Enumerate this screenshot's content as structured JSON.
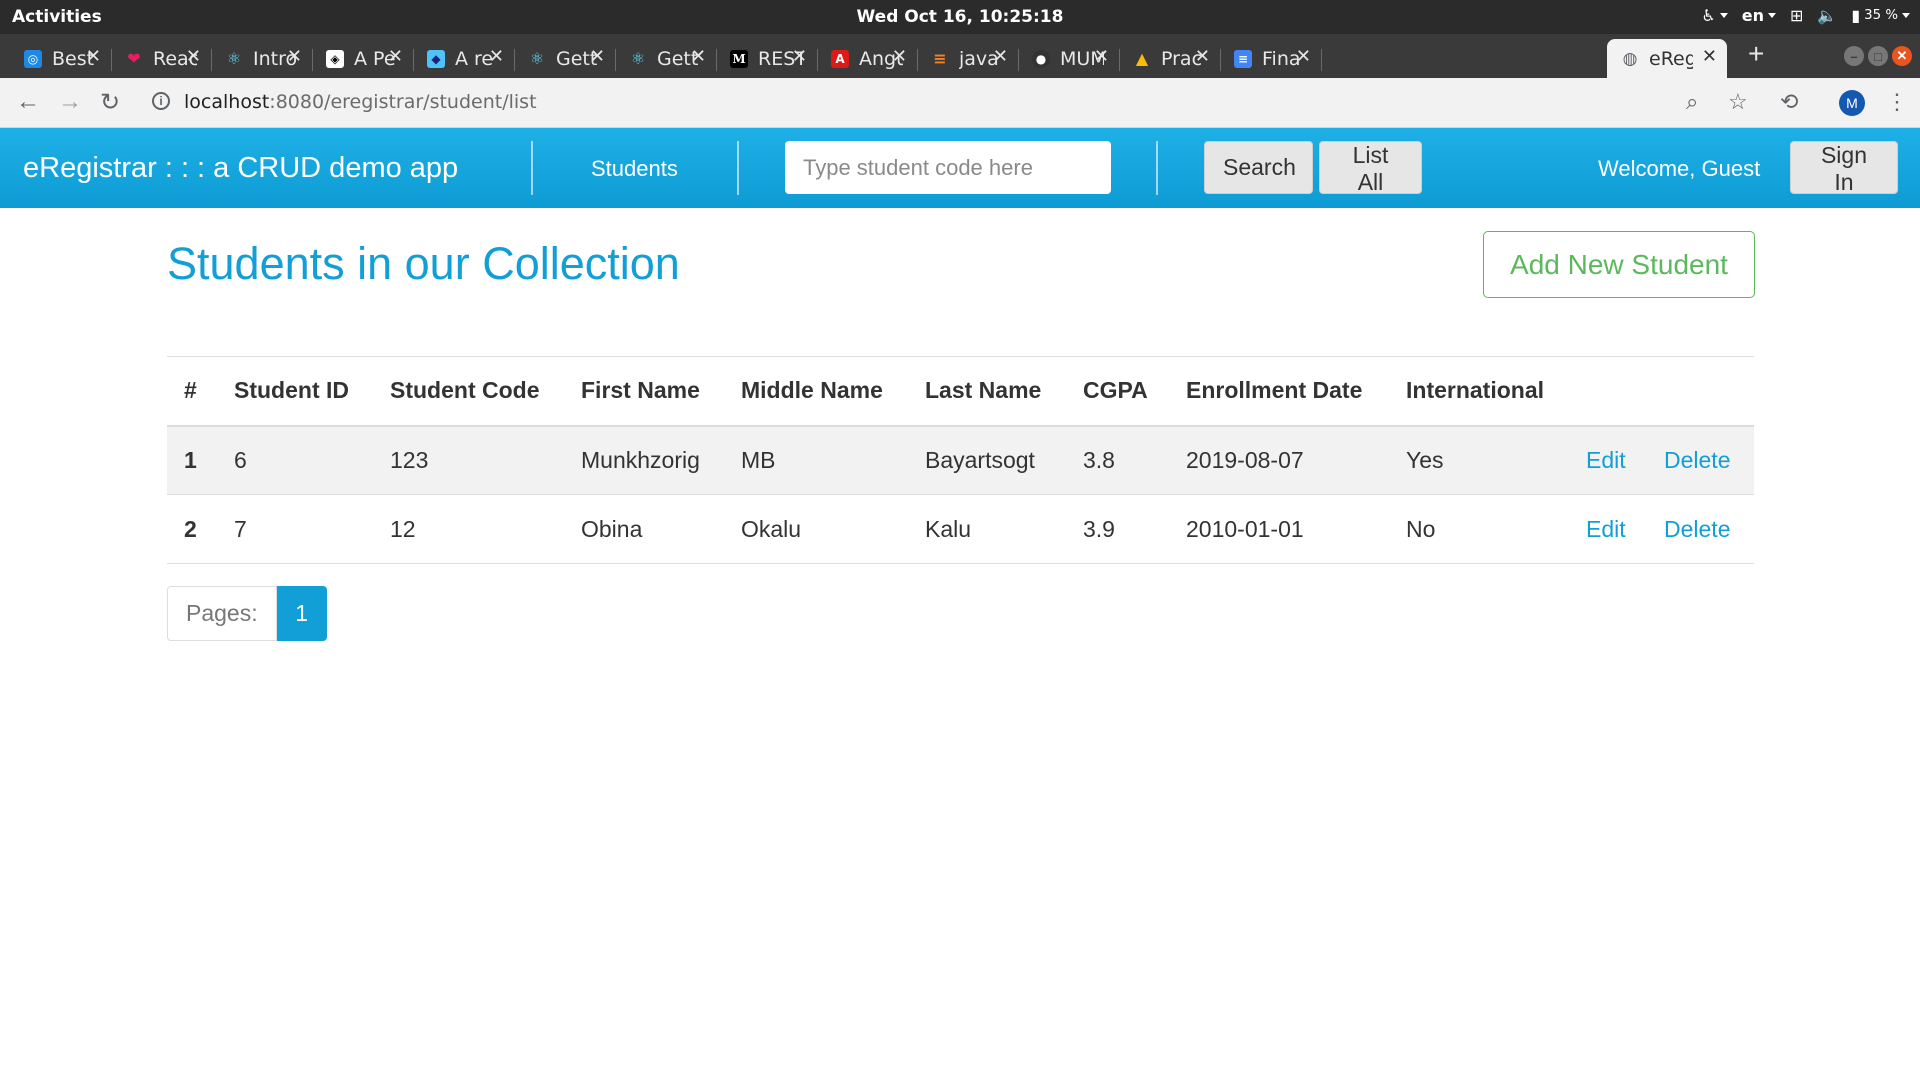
{
  "os_bar": {
    "activities": "Activities",
    "clock": "Wed Oct 16, 10:25:18",
    "language": "en",
    "battery": "35 %"
  },
  "tabs": [
    {
      "title": "Best",
      "color": "#1e88e5",
      "icon": "react-icon"
    },
    {
      "title": "Reac",
      "color": "#e91e63",
      "icon": "heart-icon"
    },
    {
      "title": "Intro",
      "color": "#61dafb",
      "icon": "react-icon"
    },
    {
      "title": "A Pe",
      "color": "#ffffff",
      "icon": "codepen-icon"
    },
    {
      "title": "A re",
      "color": "#4fc3f7",
      "icon": "tag-icon"
    },
    {
      "title": "Gett",
      "color": "#61dafb",
      "icon": "react-icon"
    },
    {
      "title": "Gett",
      "color": "#61dafb",
      "icon": "react-icon"
    },
    {
      "title": "REST",
      "color": "#000000",
      "icon": "medium-icon"
    },
    {
      "title": "Angu",
      "color": "#dd1b16",
      "icon": "angular-icon"
    },
    {
      "title": "java",
      "color": "#f48024",
      "icon": "stackoverflow-icon"
    },
    {
      "title": "MUM",
      "color": "#333333",
      "icon": "github-icon"
    },
    {
      "title": "Prac",
      "color": "#fbbc04",
      "icon": "drive-icon"
    },
    {
      "title": "Fina",
      "color": "#4285f4",
      "icon": "docs-icon"
    },
    {
      "title": "eReg",
      "color": "#5f6368",
      "icon": "globe-icon"
    }
  ],
  "address_bar": {
    "host": "localhost",
    "path": ":8080/eregistrar/student/list",
    "avatar_letter": "M"
  },
  "app_nav": {
    "brand": "eRegistrar : : : a CRUD demo app",
    "students_link": "Students",
    "search_placeholder": "Type student code here",
    "search_button": "Search",
    "list_all_button": "List All",
    "welcome": "Welcome, Guest",
    "sign_in_button": "Sign In"
  },
  "page": {
    "title": "Students in our Collection",
    "add_button": "Add New Student"
  },
  "table": {
    "headers": [
      "#",
      "Student ID",
      "Student Code",
      "First Name",
      "Middle Name",
      "Last Name",
      "CGPA",
      "Enrollment Date",
      "International"
    ],
    "rows": [
      {
        "num": "1",
        "id": "6",
        "code": "123",
        "first": "Munkhzorig",
        "middle": "MB",
        "last": "Bayartsogt",
        "cgpa": "3.8",
        "date": "2019-08-07",
        "intl": "Yes",
        "edit": "Edit",
        "delete": "Delete"
      },
      {
        "num": "2",
        "id": "7",
        "code": "12",
        "first": "Obina",
        "middle": "Okalu",
        "last": "Kalu",
        "cgpa": "3.9",
        "date": "2010-01-01",
        "intl": "No",
        "edit": "Edit",
        "delete": "Delete"
      }
    ]
  },
  "pagination": {
    "label": "Pages:",
    "current": "1"
  },
  "colors": {
    "navbar": "#1eb0e6",
    "title": "#129fd8",
    "add_button": "#5cb85c"
  }
}
